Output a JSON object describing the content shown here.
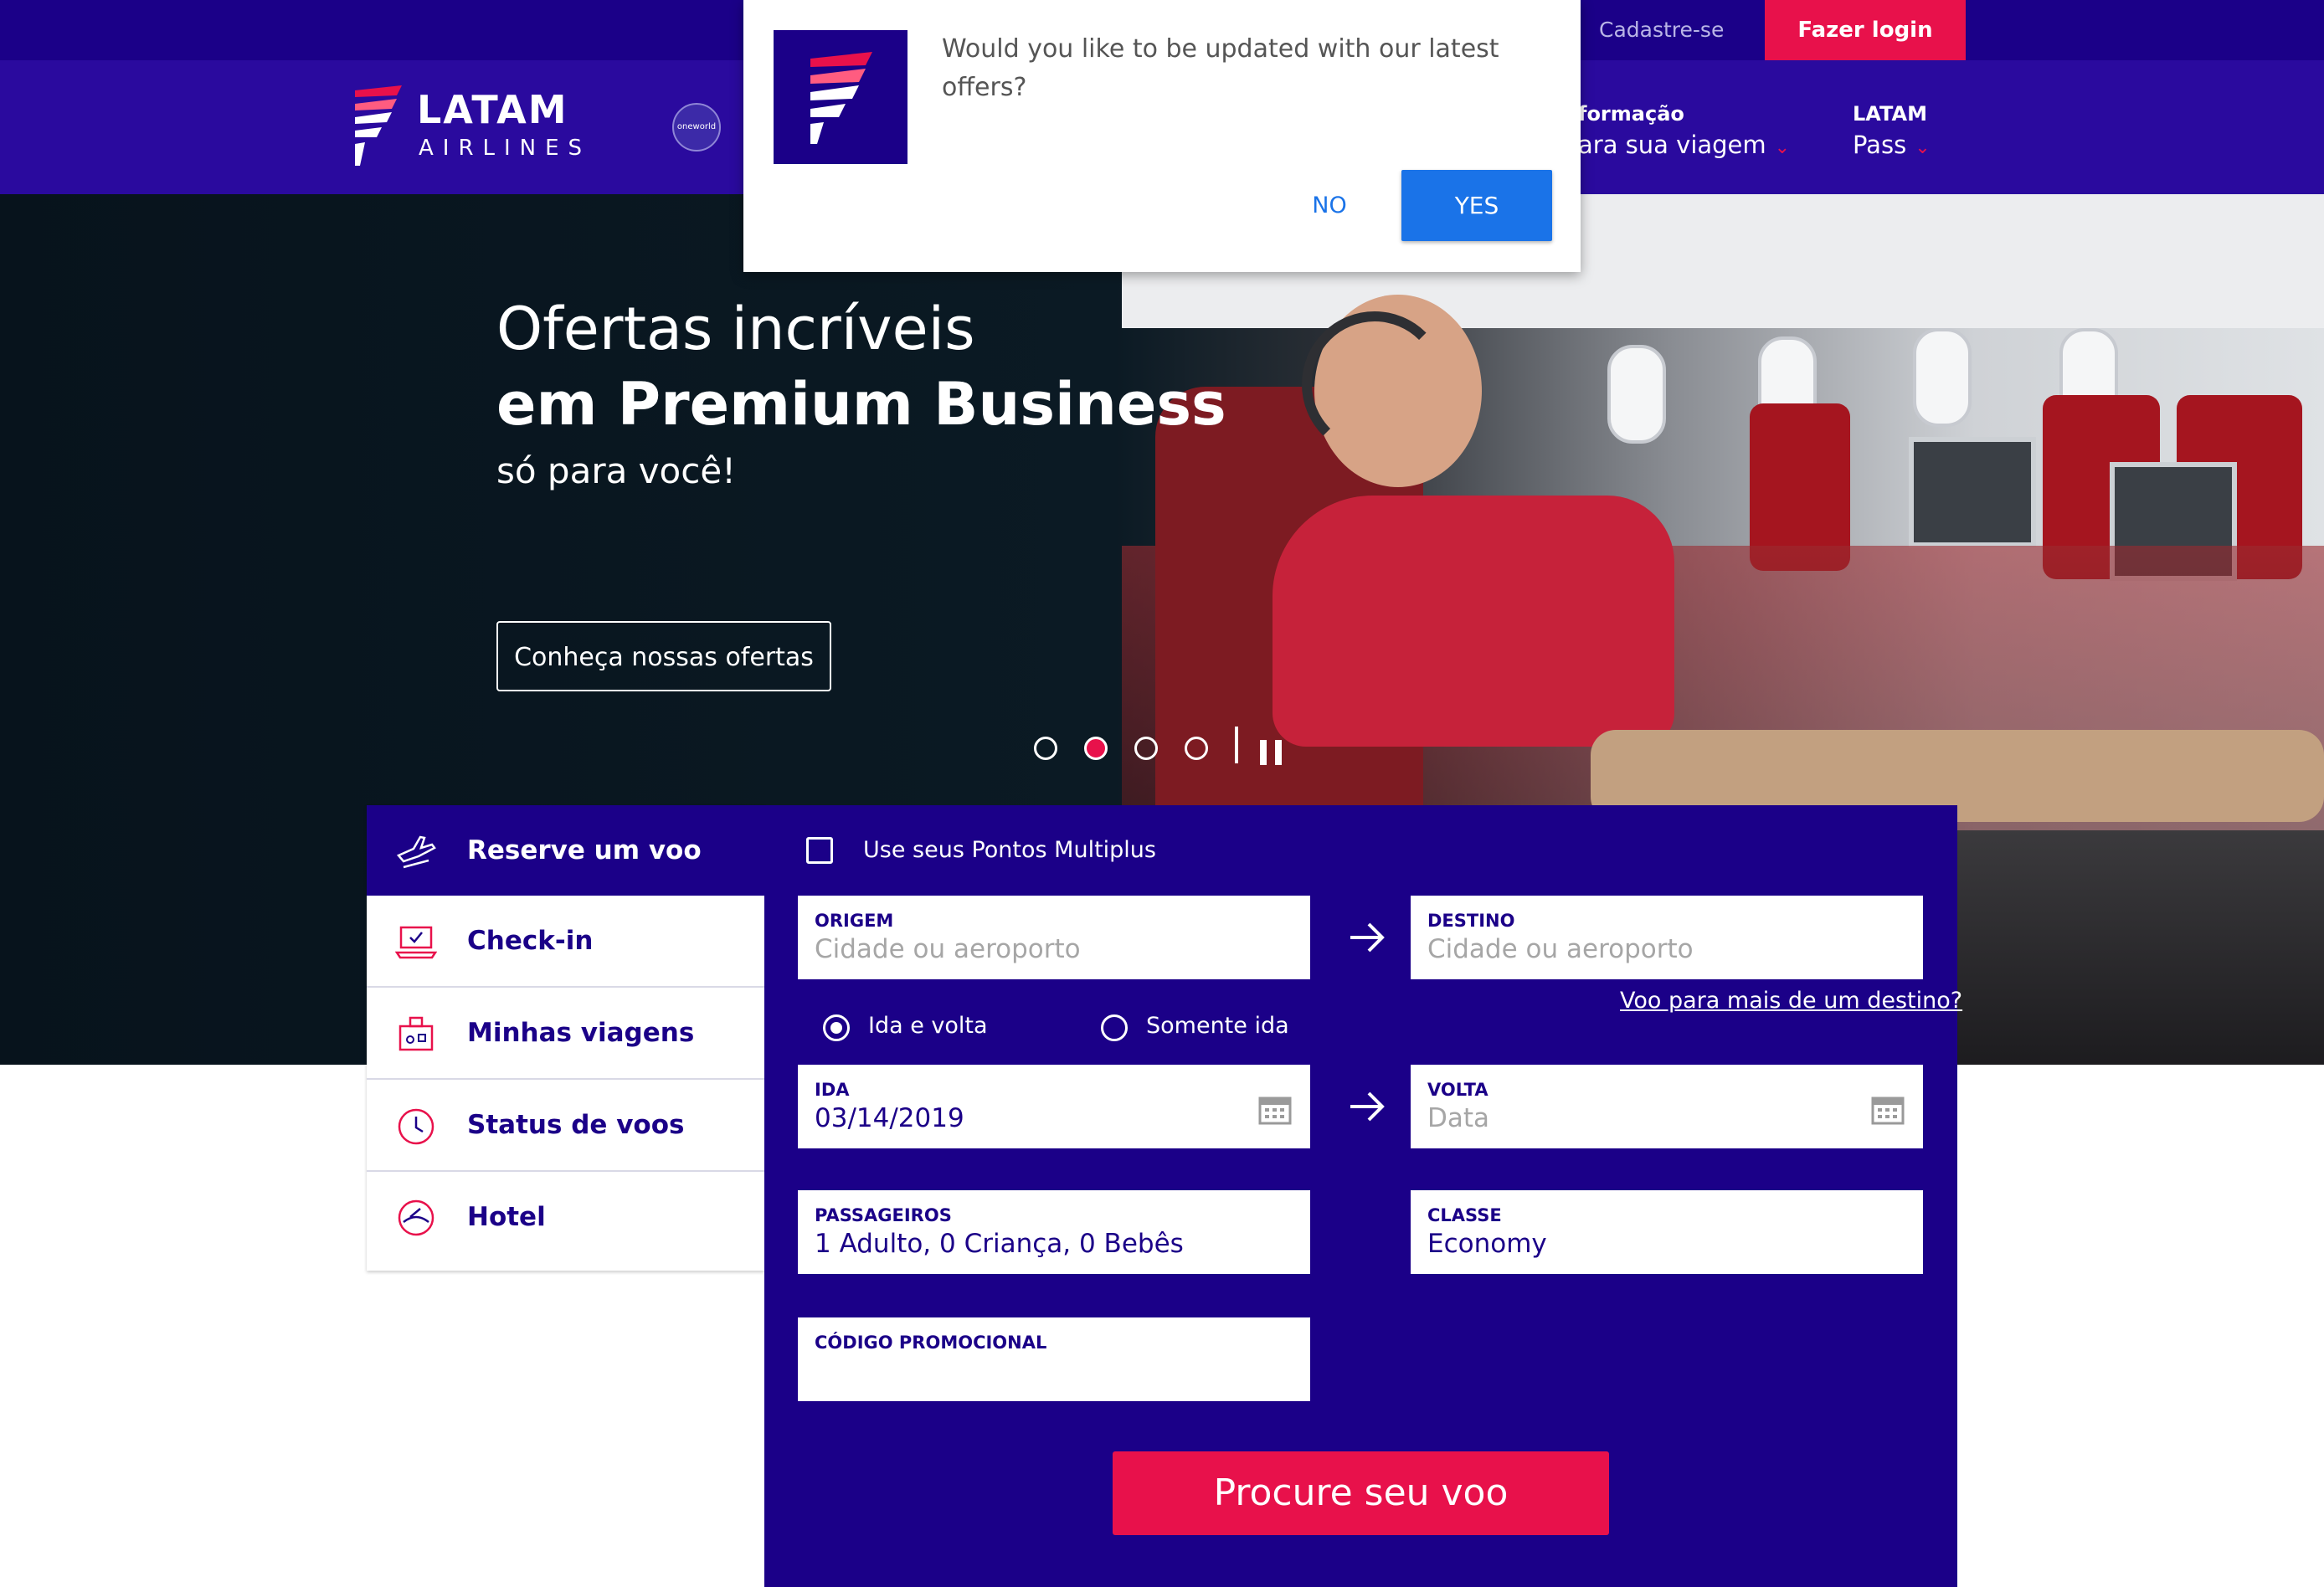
{
  "topbar": {
    "register": "Cadastre-se",
    "login": "Fazer login"
  },
  "nav": {
    "logo_brand": "LATAM",
    "logo_sub": "AIRLINES",
    "oneworld": "oneworld",
    "items": [
      {
        "line1": "formação",
        "line2": "ara sua viagem"
      },
      {
        "line1": "LATAM",
        "line2": "Pass"
      }
    ]
  },
  "hero": {
    "line1": "Ofertas incríveis",
    "line2": "em Premium Business",
    "line3": "só para você!",
    "cta": "Conheça nossas ofertas",
    "slides": 4,
    "active_slide": 2
  },
  "sidebar": {
    "items": [
      {
        "label": "Reserve um voo",
        "icon": "plane-icon"
      },
      {
        "label": "Check-in",
        "icon": "laptop-check-icon"
      },
      {
        "label": "Minhas viagens",
        "icon": "luggage-icon"
      },
      {
        "label": "Status de voos",
        "icon": "clock-icon"
      },
      {
        "label": "Hotel",
        "icon": "hotel-icon"
      }
    ]
  },
  "booking": {
    "points_label": "Use seus Pontos Multiplus",
    "origin": {
      "label": "ORIGEM",
      "placeholder": "Cidade ou aeroporto"
    },
    "destination": {
      "label": "DESTINO",
      "placeholder": "Cidade ou aeroporto"
    },
    "multi_dest": "Voo para mais de um destino?",
    "trip_types": [
      "Ida e volta",
      "Somente ida"
    ],
    "depart": {
      "label": "IDA",
      "value": "03/14/2019"
    },
    "return": {
      "label": "VOLTA",
      "placeholder": "Data"
    },
    "passengers": {
      "label": "PASSAGEIROS",
      "value": "1 Adulto, 0 Criança, 0 Bebês"
    },
    "cabin": {
      "label": "CLASSE",
      "value": "Economy"
    },
    "promo": {
      "label": "CÓDIGO PROMOCIONAL",
      "value": ""
    },
    "search": "Procure seu voo"
  },
  "popup": {
    "message": "Would you like to be updated with our latest offers?",
    "no": "NO",
    "yes": "YES"
  },
  "colors": {
    "brand": "#1b0088",
    "accent": "#e8114b",
    "popup_button": "#1a73e8"
  }
}
